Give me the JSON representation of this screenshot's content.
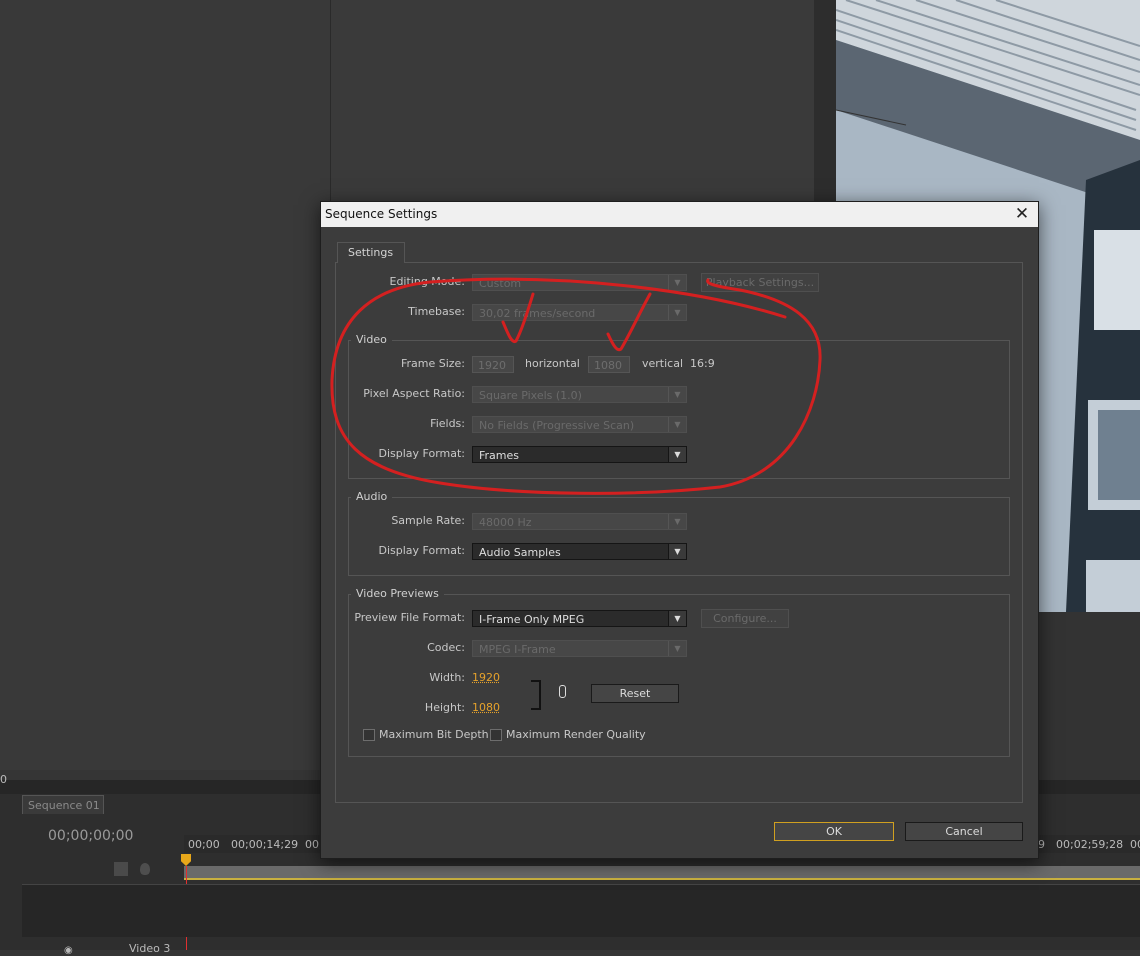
{
  "dialog": {
    "title": "Sequence Settings",
    "close_glyph": "✕",
    "tab": "Settings",
    "editing_mode": {
      "label": "Editing Mode:",
      "value": "Custom"
    },
    "playback_settings": "Playback Settings...",
    "timebase": {
      "label": "Timebase:",
      "value": "30,02 frames/second"
    },
    "video": {
      "title": "Video",
      "frame_size_label": "Frame Size:",
      "width": "1920",
      "horizontal": "horizontal",
      "height": "1080",
      "vertical": "vertical",
      "aspect": "16:9",
      "pixel_aspect_label": "Pixel Aspect Ratio:",
      "pixel_aspect": "Square Pixels (1.0)",
      "fields_label": "Fields:",
      "fields": "No Fields (Progressive Scan)",
      "display_format_label": "Display Format:",
      "display_format": "Frames"
    },
    "audio": {
      "title": "Audio",
      "sample_rate_label": "Sample Rate:",
      "sample_rate": "48000 Hz",
      "display_format_label": "Display Format:",
      "display_format": "Audio Samples"
    },
    "previews": {
      "title": "Video Previews",
      "file_format_label": "Preview File Format:",
      "file_format": "I-Frame Only MPEG",
      "configure": "Configure...",
      "codec_label": "Codec:",
      "codec": "MPEG I-Frame",
      "width_label": "Width:",
      "width": "1920",
      "height_label": "Height:",
      "height": "1080",
      "reset": "Reset",
      "max_bit_depth": "Maximum Bit Depth",
      "max_render_quality": "Maximum Render Quality"
    },
    "ok": "OK",
    "cancel": "Cancel"
  },
  "timeline": {
    "tab": "Sequence 01",
    "timecode": "00;00;00;00",
    "ruler": [
      "00;00",
      "00;00;14;29",
      "00;",
      "00;02;59;28",
      "00"
    ],
    "ruler_right_partial": "9",
    "track": "Video 3",
    "left_fragment": "0"
  },
  "annotation_color": "#d42020"
}
